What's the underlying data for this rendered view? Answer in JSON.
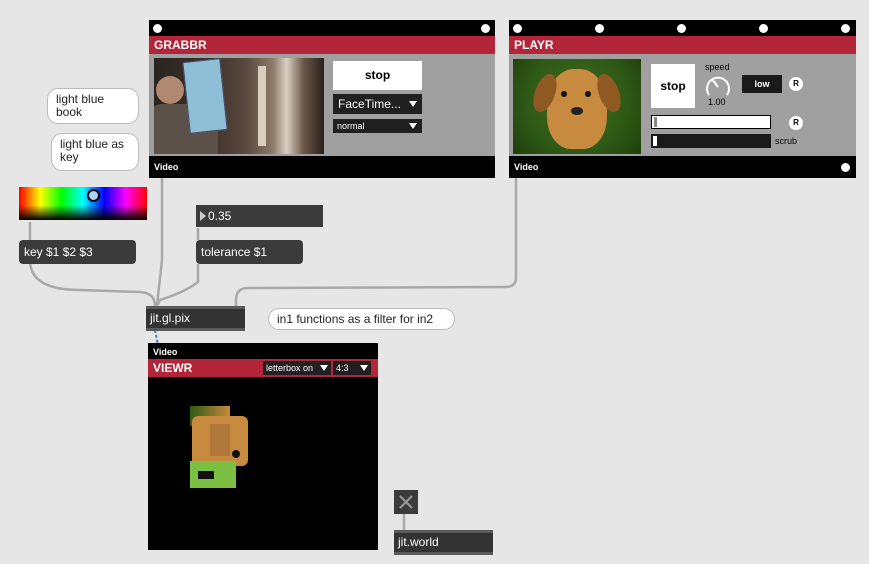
{
  "grabbr": {
    "title": "GRABBR",
    "stop_label": "stop",
    "device_menu": "FaceTime...",
    "mode_menu": "normal",
    "footer": "Video"
  },
  "playr": {
    "title": "PLAYR",
    "stop_label": "stop",
    "speed_label": "speed",
    "speed_value": "1.00",
    "quality_btn": "low",
    "reset_label": "R",
    "scrub_label": "scrub",
    "footer": "Video"
  },
  "viewr": {
    "top_label": "Video",
    "title": "VIEWR",
    "letterbox_menu": "letterbox on",
    "aspect_menu": "4:3"
  },
  "comments": {
    "light_blue_book": "light blue book",
    "light_blue_key": "light blue as key",
    "filter_note": "in1 functions as a filter for in2"
  },
  "objects": {
    "number_value": "0.35",
    "key_msg": "key $1 $2 $3",
    "tolerance_msg": "tolerance $1",
    "gl_pix": "jit.gl.pix",
    "jit_world": "jit.world"
  },
  "colors": {
    "accent": "#b3263a",
    "patch_bg": "#e6e6e6"
  }
}
